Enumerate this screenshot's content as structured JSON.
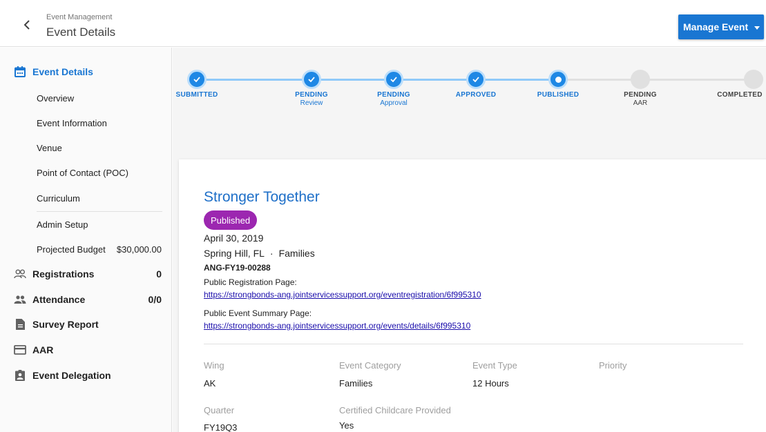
{
  "header": {
    "breadcrumb": "Event Management",
    "title": "Event Details",
    "manage_button": "Manage Event"
  },
  "sidebar": {
    "event_details": "Event Details",
    "subitems": [
      "Overview",
      "Event Information",
      "Venue",
      "Point of Contact (POC)",
      "Curriculum",
      "Admin Setup"
    ],
    "projected_budget_label": "Projected Budget",
    "projected_budget_value": "$30,000.00",
    "registrations": {
      "label": "Registrations",
      "count": "0"
    },
    "attendance": {
      "label": "Attendance",
      "count": "0/0"
    },
    "survey_report": "Survey Report",
    "aar": "AAR",
    "event_delegation": "Event Delegation"
  },
  "stepper": {
    "steps": [
      {
        "label": "SUBMITTED",
        "sub": "",
        "state": "done"
      },
      {
        "label": "PENDING",
        "sub": "Review",
        "state": "done"
      },
      {
        "label": "PENDING",
        "sub": "Approval",
        "state": "done"
      },
      {
        "label": "APPROVED",
        "sub": "",
        "state": "done"
      },
      {
        "label": "PUBLISHED",
        "sub": "",
        "state": "current"
      },
      {
        "label": "PENDING",
        "sub": "AAR",
        "state": "todo"
      },
      {
        "label": "COMPLETED",
        "sub": "",
        "state": "todo"
      }
    ]
  },
  "event": {
    "title": "Stronger Together",
    "status": "Published",
    "date": "April 30, 2019",
    "location": "Spring Hill, FL",
    "audience": "Families",
    "code": "ANG-FY19-00288",
    "public_registration_label": "Public Registration Page:",
    "public_registration_url": "https://strongbonds-ang.jointservicessupport.org/eventregistration/6f995310",
    "public_summary_label": "Public Event Summary Page:",
    "public_summary_url": "https://strongbonds-ang.jointservicessupport.org/events/details/6f995310"
  },
  "fields": {
    "wing_label": "Wing",
    "wing_value": "AK",
    "category_label": "Event Category",
    "category_value": "Families",
    "type_label": "Event Type",
    "type_value": "12 Hours",
    "priority_label": "Priority",
    "priority_value": "",
    "quarter_label": "Quarter",
    "quarter_value": "FY19Q3",
    "childcare_label": "Certified Childcare Provided",
    "childcare_value": "Yes"
  },
  "colors": {
    "primary": "#1976d2",
    "badge": "#9c27b0",
    "link": "#1a0dab"
  }
}
